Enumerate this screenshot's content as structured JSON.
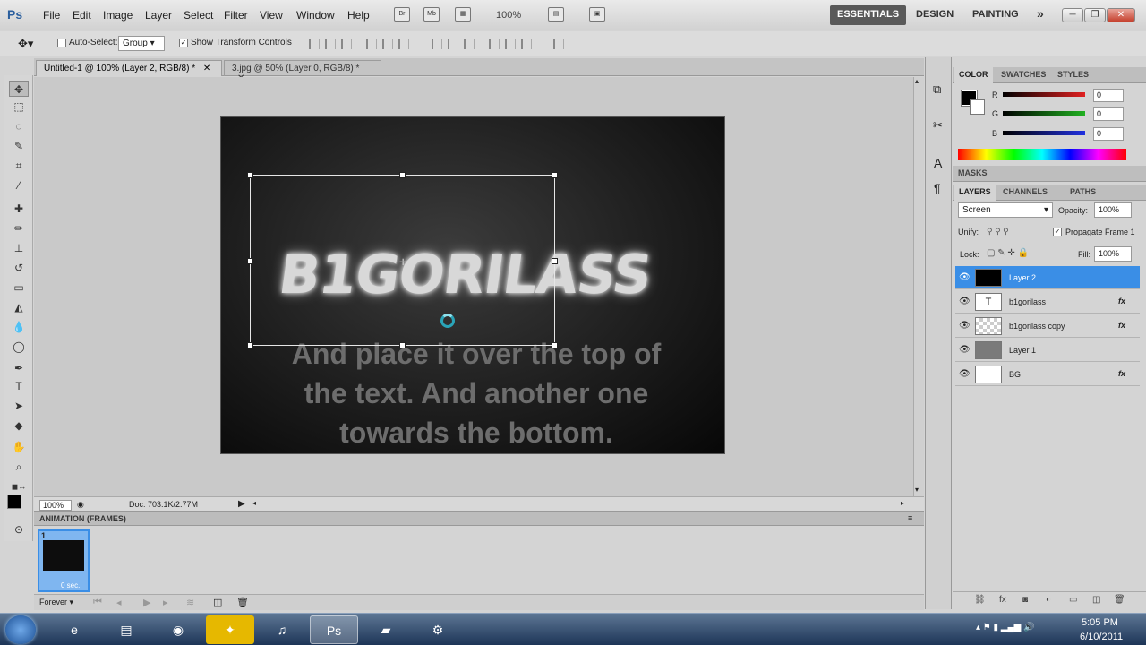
{
  "app": {
    "logo": "Ps"
  },
  "menu": [
    "File",
    "Edit",
    "Image",
    "Layer",
    "Select",
    "Filter",
    "View",
    "Window",
    "Help"
  ],
  "appbar": {
    "zoom": "100%",
    "workspaces": [
      "ESSENTIALS",
      "DESIGN",
      "PAINTING"
    ],
    "more": "»"
  },
  "options": {
    "auto_select_label": "Auto-Select:",
    "auto_select_value": "Group",
    "show_transform": "Show Transform Controls"
  },
  "tabs": [
    {
      "label": "Untitled-1 @ 100% (Layer 2, RGB/8) *",
      "close": "✕"
    },
    {
      "label": "3.jpg @ 50% (Layer 0, RGB/8) *",
      "close": "✕"
    }
  ],
  "canvas": {
    "logo_text": "B1GORILASS",
    "caption_lines": [
      "And place it over the top of",
      "the text. And another one",
      "towards the bottom."
    ]
  },
  "status": {
    "zoom": "100%",
    "doc": "Doc: 703.1K/2.77M"
  },
  "animation": {
    "title": "ANIMATION (FRAMES)",
    "frame_number": "1",
    "frame_time": "0 sec.",
    "loop": "Forever"
  },
  "color_panel": {
    "tabs": [
      "COLOR",
      "SWATCHES",
      "STYLES"
    ],
    "channels": [
      {
        "label": "R",
        "value": "0",
        "color": "#e02020"
      },
      {
        "label": "G",
        "value": "0",
        "color": "#20b020"
      },
      {
        "label": "B",
        "value": "0",
        "color": "#2030e0"
      }
    ]
  },
  "masks_panel": {
    "title": "MASKS"
  },
  "layers_panel": {
    "tabs": [
      "LAYERS",
      "CHANNELS",
      "PATHS"
    ],
    "blend_mode": "Screen",
    "opacity_label": "Opacity:",
    "opacity": "100%",
    "unify_label": "Unify:",
    "propagate": "Propagate Frame 1",
    "lock_label": "Lock:",
    "fill_label": "Fill:",
    "fill": "100%",
    "layers": [
      {
        "name": "Layer 2",
        "fx": "",
        "thumb": "",
        "selected": true
      },
      {
        "name": "b1gorilass",
        "fx": "fx",
        "thumb": "T",
        "selected": false
      },
      {
        "name": "b1gorilass copy",
        "fx": "fx",
        "thumb": "",
        "selected": false
      },
      {
        "name": "Layer 1",
        "fx": "",
        "thumb": "",
        "selected": false
      },
      {
        "name": "BG",
        "fx": "fx",
        "thumb": "",
        "selected": false
      }
    ]
  },
  "taskbar": {
    "time": "5:05 PM",
    "date": "6/10/2011"
  },
  "icons": {
    "start": "windows-start-icon",
    "apps": [
      "internet-explorer-icon",
      "file-explorer-icon",
      "chrome-icon",
      "app-icon",
      "itunes-icon",
      "photoshop-icon",
      "notes-icon",
      "tool-icon"
    ]
  }
}
